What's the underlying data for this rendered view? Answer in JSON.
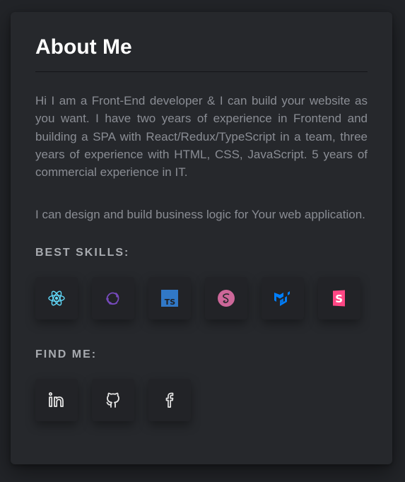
{
  "about": {
    "title": "About Me",
    "paragraph_1": "Hi I am a Front-End developer & I can build your website as you want. I have two years of experience in Frontend and building a SPA with React/Redux/TypeScript in a team, three years of experience with HTML, CSS, JavaScript. 5 years of commercial experience in IT.",
    "paragraph_2": "I can design and build business logic for Your web application.",
    "skills_heading": "BEST SKILLS:",
    "find_heading": "FIND ME:"
  },
  "skills": [
    {
      "icon": "react-icon",
      "color": "#61dafb"
    },
    {
      "icon": "redux-icon",
      "color": "#764abc"
    },
    {
      "icon": "typescript-icon",
      "color": "#3178c6"
    },
    {
      "icon": "sass-icon",
      "color": "#cd6799"
    },
    {
      "icon": "material-ui-icon",
      "color": "#007fff"
    },
    {
      "icon": "storybook-icon",
      "color": "#ff4785"
    }
  ],
  "social": [
    {
      "icon": "linkedin-icon",
      "color": "#e6e6e6"
    },
    {
      "icon": "github-icon",
      "color": "#e6e6e6"
    },
    {
      "icon": "facebook-icon",
      "color": "#e6e6e6"
    }
  ],
  "colors": {
    "background": "#222428",
    "card": "#26282c",
    "text": "#8a8d94",
    "title": "#ffffff"
  }
}
